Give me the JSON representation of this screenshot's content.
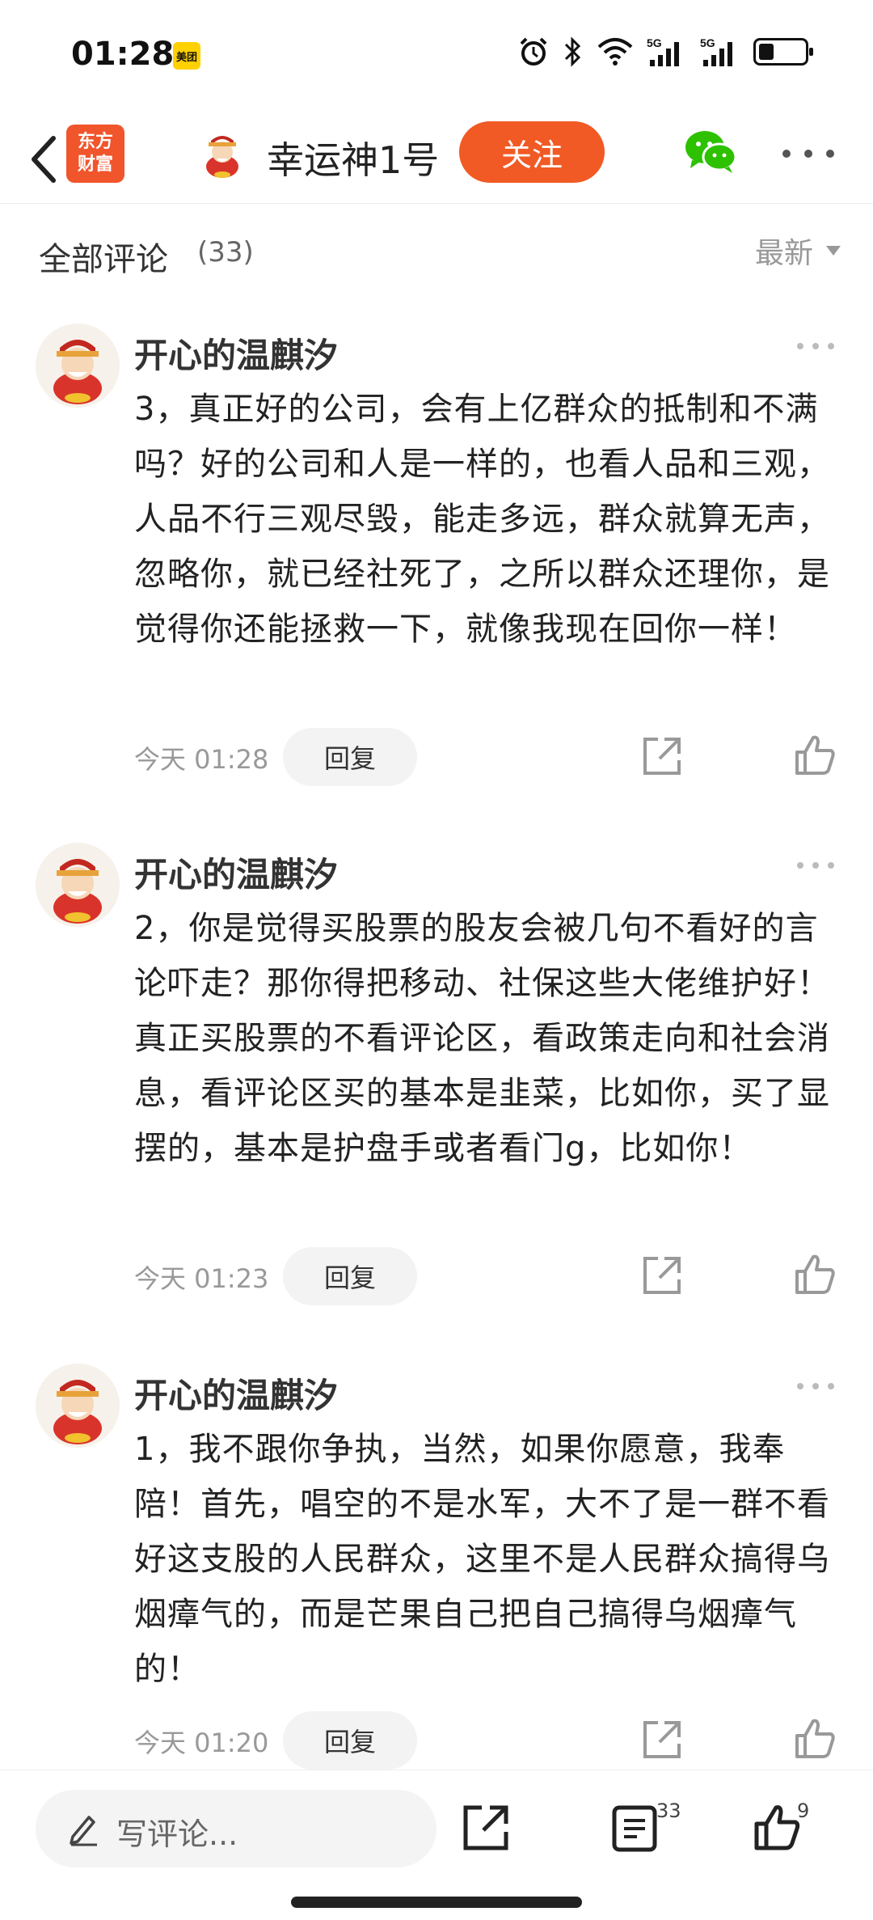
{
  "status_bar": {
    "time": "01:28",
    "app_badge": "美团",
    "network_1": "5G",
    "network_2": "5G"
  },
  "nav": {
    "logo_line1": "东方",
    "logo_line2": "财富",
    "title": "幸运神1号",
    "follow_label": "关注"
  },
  "section": {
    "title": "全部评论",
    "count": "(33)",
    "sort_label": "最新"
  },
  "comments": [
    {
      "name": "开心的温麒汐",
      "text": "3，真正好的公司，会有上亿群众的抵制和不满吗？好的公司和人是一样的，也看人品和三观，人品不行三观尽毁，能走多远，群众就算无声，忽略你，就已经社死了，之所以群众还理你，是觉得你还能拯救一下，就像我现在回你一样！",
      "time": "今天 01:28",
      "reply_label": "回复"
    },
    {
      "name": "开心的温麒汐",
      "text": "2，你是觉得买股票的股友会被几句不看好的言论吓走？那你得把移动、社保这些大佬维护好！真正买股票的不看评论区，看政策走向和社会消息，看评论区买的基本是韭菜，比如你，买了显摆的，基本是护盘手或者看门g，比如你！",
      "time": "今天 01:23",
      "reply_label": "回复"
    },
    {
      "name": "开心的温麒汐",
      "text": "1，我不跟你争执，当然，如果你愿意，我奉陪！首先，唱空的不是水军，大不了是一群不看好这支股的人民群众，这里不是人民群众搞得乌烟瘴气的，而是芒果自己把自己搞得乌烟瘴气的！",
      "time": "今天 01:20",
      "reply_label": "回复"
    }
  ],
  "bottom_bar": {
    "input_placeholder": "写评论...",
    "comment_count": "33",
    "like_count": "9"
  },
  "colors": {
    "accent": "#f15a24",
    "logo": "#f0552c",
    "wechat": "#2dc100"
  }
}
